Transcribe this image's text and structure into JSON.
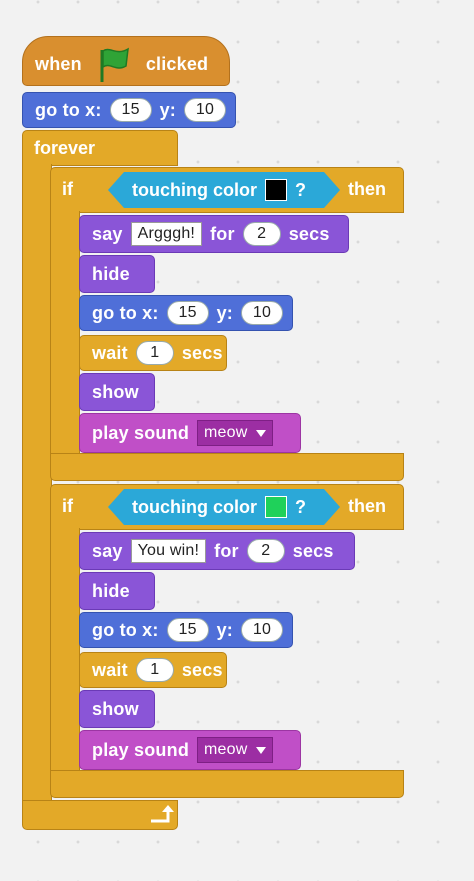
{
  "hat": {
    "when": "when",
    "clicked": "clicked",
    "flag_color": "#2fa336"
  },
  "goto1": {
    "label": "go to x:",
    "x": "15",
    "ylabel": "y:",
    "y": "10"
  },
  "forever": {
    "label": "forever"
  },
  "if1": {
    "if": "if",
    "touching": "touching color",
    "q": "?",
    "then": "then",
    "color": "#000000",
    "say": {
      "label": "say",
      "text": "Argggh!",
      "for": "for",
      "secs_val": "2",
      "secs": "secs"
    },
    "hide": "hide",
    "goto": {
      "label": "go to x:",
      "x": "15",
      "ylabel": "y:",
      "y": "10"
    },
    "wait": {
      "label": "wait",
      "val": "1",
      "secs": "secs"
    },
    "show": "show",
    "play": {
      "label": "play sound",
      "sound": "meow"
    }
  },
  "if2": {
    "if": "if",
    "touching": "touching color",
    "q": "?",
    "then": "then",
    "color": "#1fd15a",
    "say": {
      "label": "say",
      "text": "You win!",
      "for": "for",
      "secs_val": "2",
      "secs": "secs"
    },
    "hide": "hide",
    "goto": {
      "label": "go to x:",
      "x": "15",
      "ylabel": "y:",
      "y": "10"
    },
    "wait": {
      "label": "wait",
      "val": "1",
      "secs": "secs"
    },
    "show": "show",
    "play": {
      "label": "play sound",
      "sound": "meow"
    }
  }
}
